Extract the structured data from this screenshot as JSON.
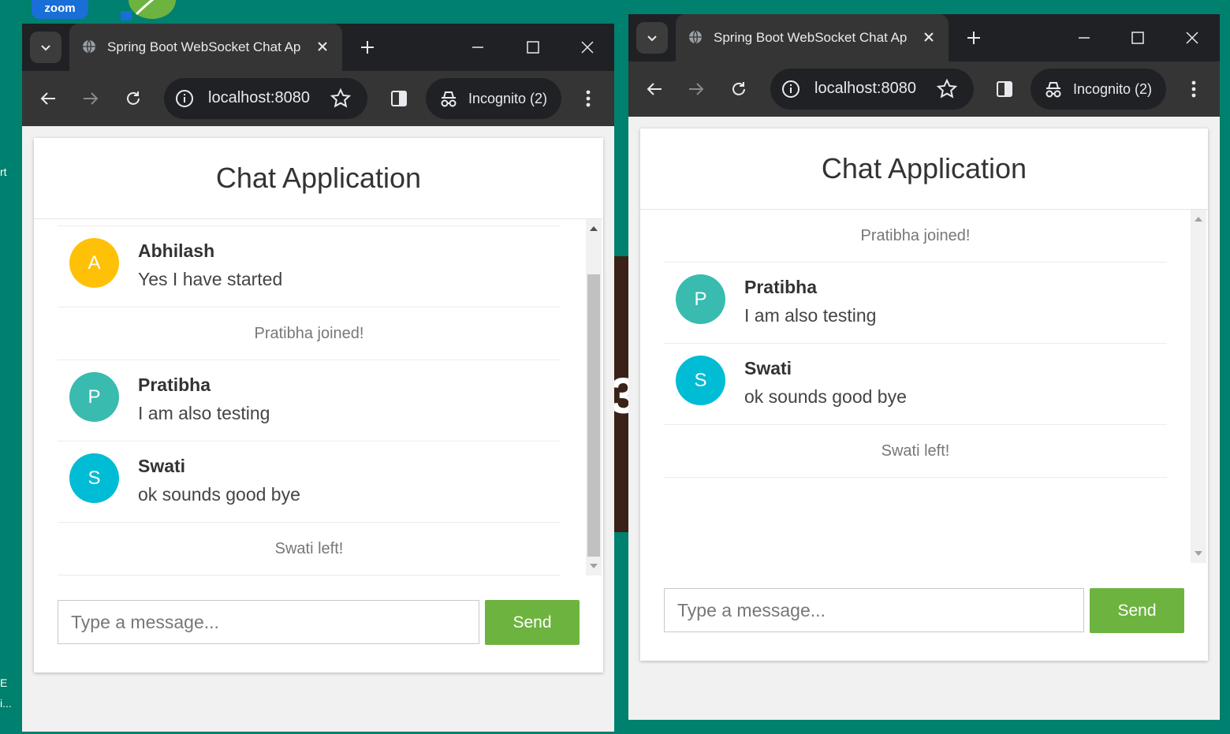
{
  "desktop": {
    "zoom_label": "zoom",
    "fragments": [
      "rt",
      "E",
      "i..."
    ]
  },
  "windows": [
    {
      "tab_title": "Spring Boot WebSocket Chat Ap",
      "url": "localhost:8080",
      "incognito_label": "Incognito (2)",
      "chat": {
        "title": "Chat Application",
        "messages": [
          {
            "type": "chat",
            "sender": "Abhilash",
            "initial": "A",
            "text": "Yes I have started",
            "color": "#ffc107"
          },
          {
            "type": "event",
            "text": "Pratibha joined!"
          },
          {
            "type": "chat",
            "sender": "Pratibha",
            "initial": "P",
            "text": "I am also testing",
            "color": "#39bbb0"
          },
          {
            "type": "chat",
            "sender": "Swati",
            "initial": "S",
            "text": "ok sounds good bye",
            "color": "#00bcd4"
          },
          {
            "type": "event",
            "text": "Swati left!"
          }
        ],
        "input_placeholder": "Type a message...",
        "send_label": "Send"
      }
    },
    {
      "tab_title": "Spring Boot WebSocket Chat Ap",
      "url": "localhost:8080",
      "incognito_label": "Incognito (2)",
      "chat": {
        "title": "Chat Application",
        "messages": [
          {
            "type": "event",
            "text": "Pratibha joined!"
          },
          {
            "type": "chat",
            "sender": "Pratibha",
            "initial": "P",
            "text": "I am also testing",
            "color": "#39bbb0"
          },
          {
            "type": "chat",
            "sender": "Swati",
            "initial": "S",
            "text": "ok sounds good bye",
            "color": "#00bcd4"
          },
          {
            "type": "event",
            "text": "Swati left!"
          }
        ],
        "input_placeholder": "Type a message...",
        "send_label": "Send"
      }
    }
  ],
  "colors": {
    "desktop_bg": "#00806e",
    "send_button": "#6db33f",
    "browser_frame": "#202124",
    "browser_toolbar": "#353535"
  }
}
